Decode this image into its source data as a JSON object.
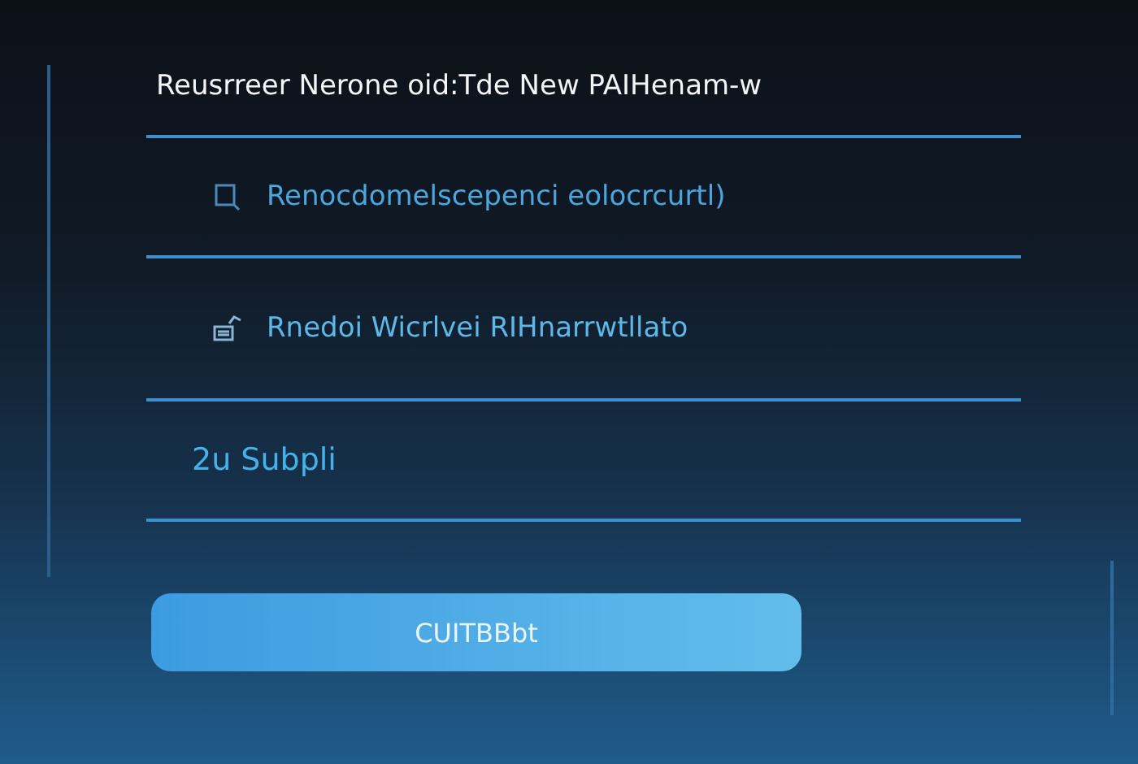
{
  "title": "Reusrreer Nerone oid:Tde New PAIHenam-w",
  "fields": [
    {
      "kind": "search",
      "value": "Renocdomelscepenci eolocrcurtl)"
    },
    {
      "kind": "edit",
      "value": "Rnedoi Wicrlvei RIHnarrwtllato"
    },
    {
      "kind": "plain",
      "value": "2u Subpli"
    }
  ],
  "button": {
    "label": "CUITBBbt"
  }
}
